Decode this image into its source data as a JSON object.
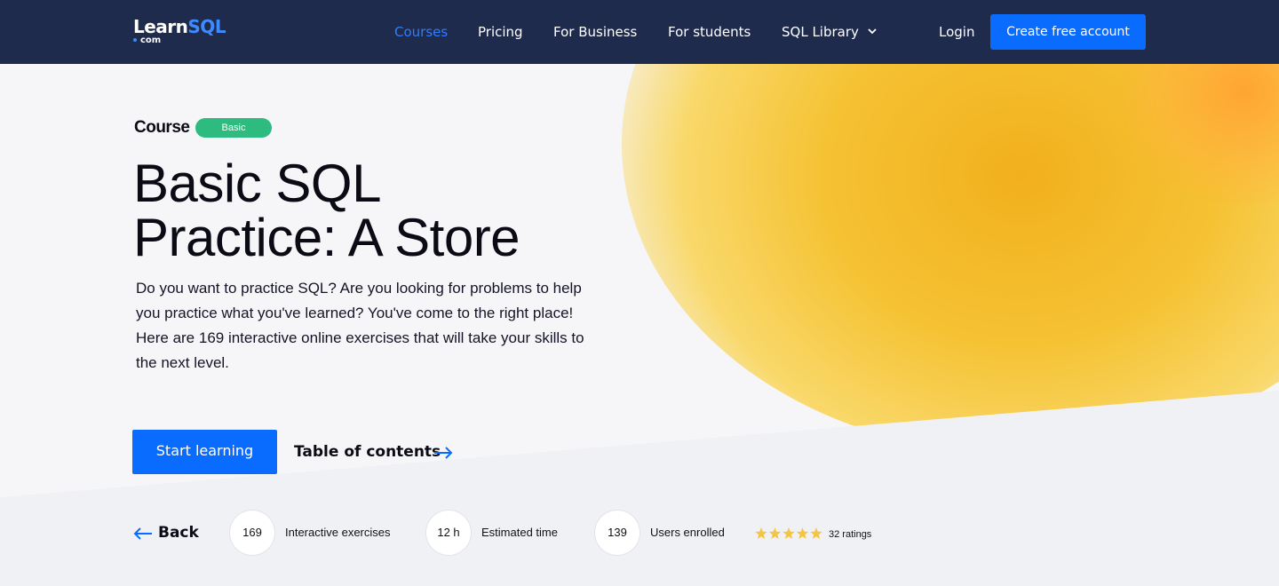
{
  "brand": {
    "logo_main": "Learn",
    "logo_accent": "SQL",
    "logo_sub": "com"
  },
  "nav": {
    "items": [
      {
        "label": "Courses"
      },
      {
        "label": "Pricing"
      },
      {
        "label": "For Business"
      },
      {
        "label": "For students"
      },
      {
        "label": "SQL Library"
      }
    ],
    "login_label": "Login",
    "create_account_label": "Create free account"
  },
  "hero": {
    "course_label": "Course",
    "level_badge": "Basic",
    "title_line1": "Basic SQL",
    "title_line2": "Practice: A Store",
    "description": "Do you want to practice SQL? Are you looking for problems to help you practice what you've learned? You've come to the right place! Here are 169 interactive online exercises that will take your skills to the next level.",
    "start_button": "Start learning",
    "toc_link": "Table of contents"
  },
  "stats": {
    "back_label": "Back",
    "items": [
      {
        "value": "169",
        "label": "Interactive exercises"
      },
      {
        "value": "12 h",
        "label": "Estimated time"
      },
      {
        "value": "139",
        "label": "Users enrolled"
      }
    ],
    "rating_stars": 5,
    "ratings_text": "32 ratings"
  },
  "colors": {
    "nav_bg": "#1f2b4d",
    "accent": "#0a6bff",
    "badge": "#2dbb7f",
    "stars": "#f5c542"
  },
  "icons": [
    "chevron-down-icon",
    "arrow-right-icon",
    "arrow-left-icon",
    "star-icon"
  ]
}
